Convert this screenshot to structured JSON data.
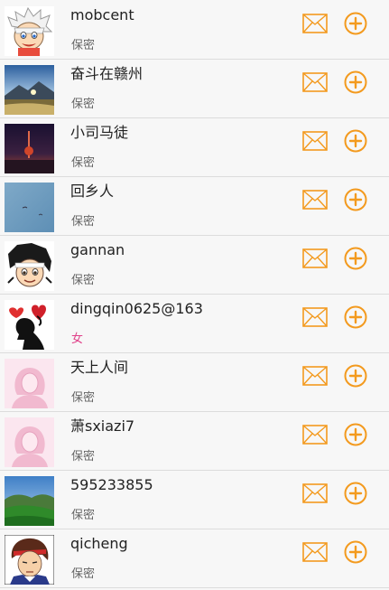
{
  "accent_color": "#f39a1e",
  "female_color": "#e0428a",
  "users": [
    {
      "name": "mobcent",
      "gender": "保密",
      "avatar": "cartoon-boy-white-hair",
      "female": false
    },
    {
      "name": "奋斗在赣州",
      "gender": "保密",
      "avatar": "mountain-sunset-photo",
      "female": false
    },
    {
      "name": "小司马徒",
      "gender": "保密",
      "avatar": "night-tower-photo",
      "female": false
    },
    {
      "name": "回乡人",
      "gender": "保密",
      "avatar": "blue-sky-photo",
      "female": false
    },
    {
      "name": "gannan",
      "gender": "保密",
      "avatar": "cartoon-boy-black-hair",
      "female": false
    },
    {
      "name": "dingqin0625@163",
      "gender": "女",
      "avatar": "silhouette-heart",
      "female": true
    },
    {
      "name": "天上人间",
      "gender": "保密",
      "avatar": "default-female-avatar",
      "female": false
    },
    {
      "name": "萧sxiazi7",
      "gender": "保密",
      "avatar": "default-female-avatar",
      "female": false
    },
    {
      "name": "595233855",
      "gender": "保密",
      "avatar": "green-hills-photo",
      "female": false
    },
    {
      "name": "qicheng",
      "gender": "保密",
      "avatar": "anime-fighter-portrait",
      "female": false
    }
  ]
}
